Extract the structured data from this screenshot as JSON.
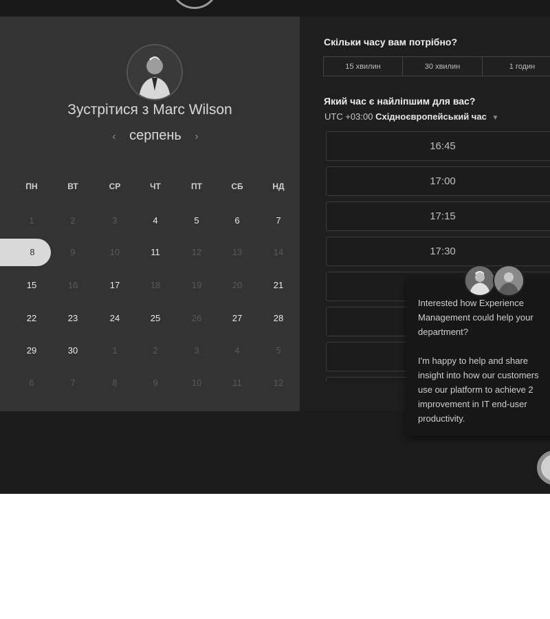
{
  "scheduler": {
    "meet_title": "Зустрітися з Marc Wilson",
    "month": "серпень",
    "prev_icon": "chevron-left-icon",
    "next_icon": "chevron-right-icon",
    "weekdays": [
      "ПН",
      "ВТ",
      "СР",
      "ЧТ",
      "ПТ",
      "СБ",
      "НД"
    ],
    "days": [
      [
        "1",
        "2",
        "3",
        "4",
        "5",
        "6",
        "7"
      ],
      [
        "8",
        "9",
        "10",
        "11",
        "12",
        "13",
        "14"
      ],
      [
        "15",
        "16",
        "17",
        "18",
        "19",
        "20",
        "21"
      ],
      [
        "22",
        "23",
        "24",
        "25",
        "26",
        "27",
        "28"
      ],
      [
        "29",
        "30",
        "1",
        "2",
        "3",
        "4",
        "5"
      ],
      [
        "6",
        "7",
        "8",
        "9",
        "10",
        "11",
        "12"
      ]
    ],
    "selected_day": "8"
  },
  "booking": {
    "duration_question": "Скільки часу вам потрібно?",
    "durations": [
      "15 хвилин",
      "30 хвилин",
      "1 годин"
    ],
    "time_question": "Який час є найліпшим для вас?",
    "tz_offset": "UTC +03:00",
    "tz_name": "Східноєвропейський час",
    "slots": [
      "16:45",
      "17:00",
      "17:15",
      "17:30",
      "",
      "",
      "",
      ""
    ]
  },
  "chat": {
    "message": "Interested how Experience Management could help your department?\n\nI'm happy to help and share insight into how our customers use our platform to achieve 2 improvement in IT end-user productivity."
  }
}
